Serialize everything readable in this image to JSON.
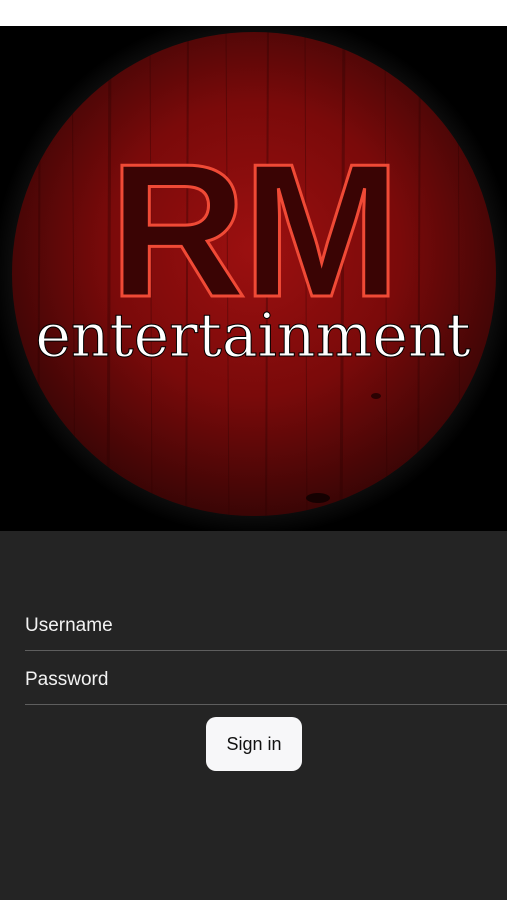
{
  "logo": {
    "monogram": "RM",
    "wordmark": "entertainment"
  },
  "login": {
    "username_placeholder": "Username",
    "password_placeholder": "Password",
    "signin_label": "Sign in"
  },
  "colors": {
    "screen_background": "#242424",
    "hero_background": "#000000",
    "logo_red": "#8a0c0c",
    "outline_red": "#e23a2a",
    "button_background": "#f7f7f9"
  }
}
